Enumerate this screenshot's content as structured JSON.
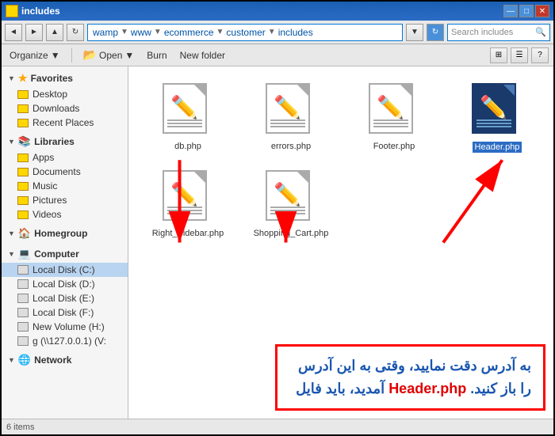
{
  "window": {
    "title": "includes",
    "title_icon": "folder",
    "controls": {
      "minimize": "—",
      "maximize": "□",
      "close": "✕"
    }
  },
  "address_bar": {
    "back": "◄",
    "forward": "►",
    "up": "▲",
    "refresh": "↻",
    "path": {
      "crumbs": [
        "wamp",
        "www",
        "ecommerce",
        "customer",
        "includes"
      ],
      "separator": "▼"
    },
    "search_placeholder": "Search includes",
    "search_icon": "🔍"
  },
  "toolbar": {
    "organize": "Organize",
    "open": "Open",
    "burn": "Burn",
    "new_folder": "New folder",
    "views": [
      "⊞",
      "☰"
    ],
    "help": "?"
  },
  "sidebar": {
    "favorites": {
      "label": "Favorites",
      "items": [
        {
          "name": "Desktop",
          "icon": "folder"
        },
        {
          "name": "Downloads",
          "icon": "folder"
        },
        {
          "name": "Recent Places",
          "icon": "folder"
        }
      ]
    },
    "libraries": {
      "label": "Libraries",
      "items": [
        {
          "name": "Apps",
          "icon": "folder"
        },
        {
          "name": "Documents",
          "icon": "folder"
        },
        {
          "name": "Music",
          "icon": "folder"
        },
        {
          "name": "Pictures",
          "icon": "folder"
        },
        {
          "name": "Videos",
          "icon": "folder"
        }
      ]
    },
    "homegroup": {
      "label": "Homegroup"
    },
    "computer": {
      "label": "Computer",
      "items": [
        {
          "name": "Local Disk (C:)",
          "icon": "disk"
        },
        {
          "name": "Local Disk (D:)",
          "icon": "disk"
        },
        {
          "name": "Local Disk (E:)",
          "icon": "disk"
        },
        {
          "name": "Local Disk (F:)",
          "icon": "disk"
        },
        {
          "name": "New Volume (H:)",
          "icon": "disk"
        },
        {
          "name": "g (\\\\127.0.0.1) (V:",
          "icon": "disk"
        }
      ]
    },
    "network": {
      "label": "Network"
    }
  },
  "files": [
    {
      "name": "db.php",
      "selected": false
    },
    {
      "name": "errors.php",
      "selected": false
    },
    {
      "name": "Footer.php",
      "selected": false
    },
    {
      "name": "Header.php",
      "selected": true
    },
    {
      "name": "Right_Sidebar.php",
      "selected": false
    },
    {
      "name": "Shopping_Cart.php",
      "selected": false
    }
  ],
  "overlay": {
    "line1": "به آدرس دقت نمایید، وقتی به این آدرس",
    "line2_part1": "آمدید، باید فایل ",
    "line2_bold": "Header.php",
    "line2_part2": " را باز کنید."
  },
  "status_bar": {
    "text": "6 items"
  }
}
